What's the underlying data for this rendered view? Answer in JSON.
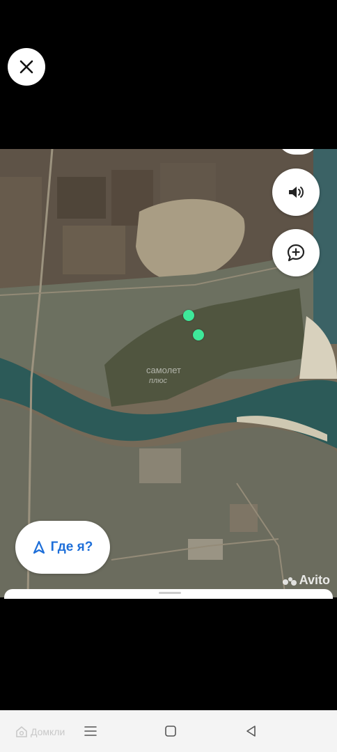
{
  "viewer": {
    "close_icon": "close-icon"
  },
  "map": {
    "sound_icon": "speaker-icon",
    "comment_icon": "chat-plus-icon",
    "where_button": {
      "label": "Где я?",
      "icon": "location-arrow-icon"
    },
    "watermark": {
      "line1": "самолет",
      "line2": "плюс"
    },
    "avito_watermark": "Avito",
    "pin_color": "#3ee89a"
  },
  "navbar": {
    "brand": "Домкли",
    "menu_icon": "menu-lines-icon",
    "home_icon": "square-home-icon",
    "back_icon": "triangle-back-icon"
  },
  "colors": {
    "accent_blue": "#1e6fd9",
    "river": "#2c5a58"
  }
}
